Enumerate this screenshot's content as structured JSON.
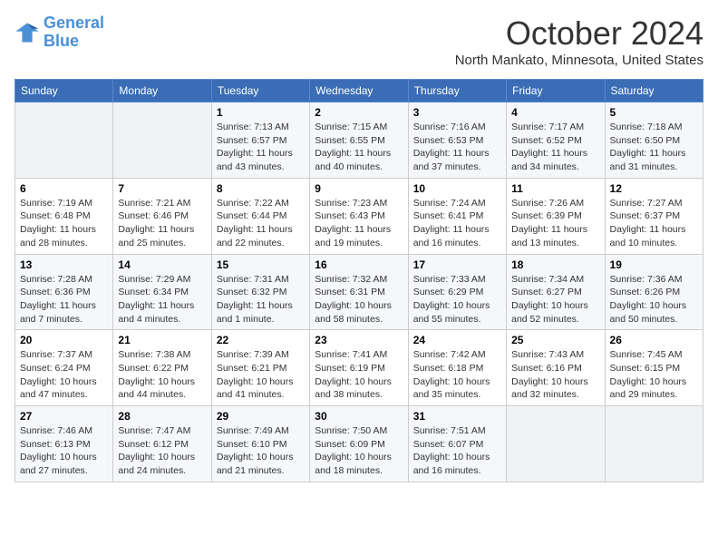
{
  "logo": {
    "text_general": "General",
    "text_blue": "Blue"
  },
  "title": "October 2024",
  "location": "North Mankato, Minnesota, United States",
  "weekdays": [
    "Sunday",
    "Monday",
    "Tuesday",
    "Wednesday",
    "Thursday",
    "Friday",
    "Saturday"
  ],
  "weeks": [
    [
      {
        "day": "",
        "info": ""
      },
      {
        "day": "",
        "info": ""
      },
      {
        "day": "1",
        "info": "Sunrise: 7:13 AM\nSunset: 6:57 PM\nDaylight: 11 hours and 43 minutes."
      },
      {
        "day": "2",
        "info": "Sunrise: 7:15 AM\nSunset: 6:55 PM\nDaylight: 11 hours and 40 minutes."
      },
      {
        "day": "3",
        "info": "Sunrise: 7:16 AM\nSunset: 6:53 PM\nDaylight: 11 hours and 37 minutes."
      },
      {
        "day": "4",
        "info": "Sunrise: 7:17 AM\nSunset: 6:52 PM\nDaylight: 11 hours and 34 minutes."
      },
      {
        "day": "5",
        "info": "Sunrise: 7:18 AM\nSunset: 6:50 PM\nDaylight: 11 hours and 31 minutes."
      }
    ],
    [
      {
        "day": "6",
        "info": "Sunrise: 7:19 AM\nSunset: 6:48 PM\nDaylight: 11 hours and 28 minutes."
      },
      {
        "day": "7",
        "info": "Sunrise: 7:21 AM\nSunset: 6:46 PM\nDaylight: 11 hours and 25 minutes."
      },
      {
        "day": "8",
        "info": "Sunrise: 7:22 AM\nSunset: 6:44 PM\nDaylight: 11 hours and 22 minutes."
      },
      {
        "day": "9",
        "info": "Sunrise: 7:23 AM\nSunset: 6:43 PM\nDaylight: 11 hours and 19 minutes."
      },
      {
        "day": "10",
        "info": "Sunrise: 7:24 AM\nSunset: 6:41 PM\nDaylight: 11 hours and 16 minutes."
      },
      {
        "day": "11",
        "info": "Sunrise: 7:26 AM\nSunset: 6:39 PM\nDaylight: 11 hours and 13 minutes."
      },
      {
        "day": "12",
        "info": "Sunrise: 7:27 AM\nSunset: 6:37 PM\nDaylight: 11 hours and 10 minutes."
      }
    ],
    [
      {
        "day": "13",
        "info": "Sunrise: 7:28 AM\nSunset: 6:36 PM\nDaylight: 11 hours and 7 minutes."
      },
      {
        "day": "14",
        "info": "Sunrise: 7:29 AM\nSunset: 6:34 PM\nDaylight: 11 hours and 4 minutes."
      },
      {
        "day": "15",
        "info": "Sunrise: 7:31 AM\nSunset: 6:32 PM\nDaylight: 11 hours and 1 minute."
      },
      {
        "day": "16",
        "info": "Sunrise: 7:32 AM\nSunset: 6:31 PM\nDaylight: 10 hours and 58 minutes."
      },
      {
        "day": "17",
        "info": "Sunrise: 7:33 AM\nSunset: 6:29 PM\nDaylight: 10 hours and 55 minutes."
      },
      {
        "day": "18",
        "info": "Sunrise: 7:34 AM\nSunset: 6:27 PM\nDaylight: 10 hours and 52 minutes."
      },
      {
        "day": "19",
        "info": "Sunrise: 7:36 AM\nSunset: 6:26 PM\nDaylight: 10 hours and 50 minutes."
      }
    ],
    [
      {
        "day": "20",
        "info": "Sunrise: 7:37 AM\nSunset: 6:24 PM\nDaylight: 10 hours and 47 minutes."
      },
      {
        "day": "21",
        "info": "Sunrise: 7:38 AM\nSunset: 6:22 PM\nDaylight: 10 hours and 44 minutes."
      },
      {
        "day": "22",
        "info": "Sunrise: 7:39 AM\nSunset: 6:21 PM\nDaylight: 10 hours and 41 minutes."
      },
      {
        "day": "23",
        "info": "Sunrise: 7:41 AM\nSunset: 6:19 PM\nDaylight: 10 hours and 38 minutes."
      },
      {
        "day": "24",
        "info": "Sunrise: 7:42 AM\nSunset: 6:18 PM\nDaylight: 10 hours and 35 minutes."
      },
      {
        "day": "25",
        "info": "Sunrise: 7:43 AM\nSunset: 6:16 PM\nDaylight: 10 hours and 32 minutes."
      },
      {
        "day": "26",
        "info": "Sunrise: 7:45 AM\nSunset: 6:15 PM\nDaylight: 10 hours and 29 minutes."
      }
    ],
    [
      {
        "day": "27",
        "info": "Sunrise: 7:46 AM\nSunset: 6:13 PM\nDaylight: 10 hours and 27 minutes."
      },
      {
        "day": "28",
        "info": "Sunrise: 7:47 AM\nSunset: 6:12 PM\nDaylight: 10 hours and 24 minutes."
      },
      {
        "day": "29",
        "info": "Sunrise: 7:49 AM\nSunset: 6:10 PM\nDaylight: 10 hours and 21 minutes."
      },
      {
        "day": "30",
        "info": "Sunrise: 7:50 AM\nSunset: 6:09 PM\nDaylight: 10 hours and 18 minutes."
      },
      {
        "day": "31",
        "info": "Sunrise: 7:51 AM\nSunset: 6:07 PM\nDaylight: 10 hours and 16 minutes."
      },
      {
        "day": "",
        "info": ""
      },
      {
        "day": "",
        "info": ""
      }
    ]
  ]
}
